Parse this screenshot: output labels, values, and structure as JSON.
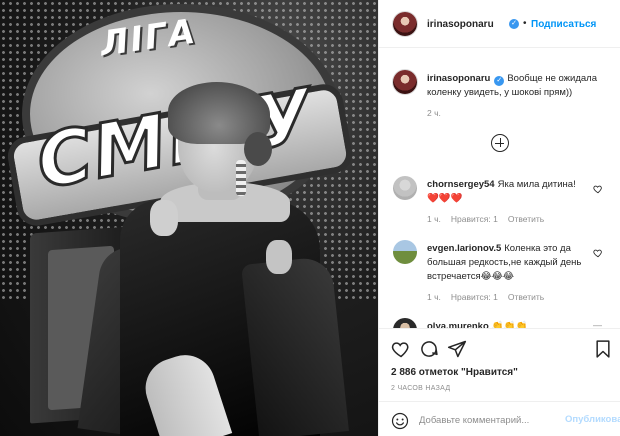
{
  "photo": {
    "logo_line1": "ЛІГА",
    "logo_line2": "СМІХУ"
  },
  "header": {
    "username": "irinasoponaru",
    "separator": "•",
    "follow_label": "Подписаться"
  },
  "caption": {
    "username": "irinasoponaru",
    "text": "Вообще не ожидала коленку увидеть, у шокові прям))",
    "time": "2 ч."
  },
  "comments": [
    {
      "username": "chornsergey54",
      "text": "Яка мила дитина! ❤️❤️❤️",
      "time": "1 ч.",
      "likes": "Нравится: 1",
      "reply": "Ответить"
    },
    {
      "username": "evgen.larionov.5",
      "text": "Коленка это да большая редкость,не каждый день встречается😂😂😂",
      "time": "1 ч.",
      "likes": "Нравится: 1",
      "reply": "Ответить"
    },
    {
      "username": "olya.murenko",
      "text": "👏👏👏",
      "more": "—"
    }
  ],
  "actions": {
    "likes_text": "2 886 отметок \"Нравится\"",
    "post_time": "2 ЧАСОВ НАЗАД",
    "add_comment_placeholder": "Добавьте комментарий...",
    "publish_label": "Опубликовать"
  },
  "colors": {
    "accent": "#0095f6",
    "verified": "#3897f0",
    "heart": "#ed4956",
    "publish_disabled": "#b3dbff"
  }
}
